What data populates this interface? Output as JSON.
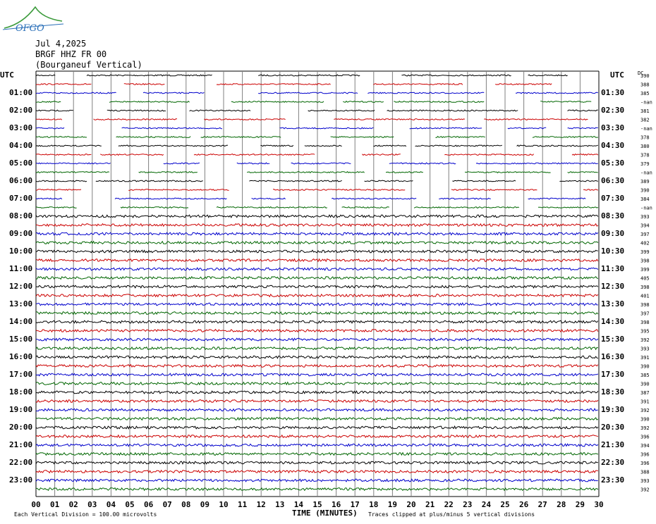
{
  "logo": {
    "text": "OFGO"
  },
  "header": {
    "date": "Jul 4,2025",
    "station": "BRGF HHZ FR 00",
    "location": "(Bourganeuf Vertical)"
  },
  "axis": {
    "left_label": "UTC",
    "right_label": "UTC",
    "dc_label": "DC",
    "xlabel": "TIME (MINUTES)",
    "left_ticks": [
      "01:00",
      "02:00",
      "03:00",
      "04:00",
      "05:00",
      "06:00",
      "07:00",
      "08:00",
      "09:00",
      "10:00",
      "11:00",
      "12:00",
      "13:00",
      "14:00",
      "15:00",
      "16:00",
      "17:00",
      "18:00",
      "19:00",
      "20:00",
      "21:00",
      "22:00",
      "23:00"
    ],
    "right_ticks": [
      "01:30",
      "02:30",
      "03:30",
      "04:30",
      "05:30",
      "06:30",
      "07:30",
      "08:30",
      "09:30",
      "10:30",
      "11:30",
      "12:30",
      "13:30",
      "14:30",
      "15:30",
      "16:30",
      "17:30",
      "18:30",
      "19:30",
      "20:30",
      "21:30",
      "22:30",
      "23:30"
    ],
    "x_ticks": [
      "00",
      "01",
      "02",
      "03",
      "04",
      "05",
      "06",
      "07",
      "08",
      "09",
      "10",
      "11",
      "12",
      "13",
      "14",
      "15",
      "16",
      "17",
      "18",
      "19",
      "20",
      "21",
      "22",
      "23",
      "24",
      "25",
      "26",
      "27",
      "28",
      "29",
      "30"
    ]
  },
  "footer": {
    "scale": "Each Vertical Division =  100.00 microvolts",
    "clip": "Traces clipped at plus/minus 5 vertical divisions"
  },
  "colors": {
    "black": "#000000",
    "red": "#cc0000",
    "blue": "#0000cc",
    "green": "#006600",
    "grid": "#808080"
  },
  "chart_data": {
    "type": "line",
    "title": "BRGF HHZ FR 00 (Bourganeuf Vertical)",
    "xlabel": "TIME (MINUTES)",
    "xlim": [
      0,
      30
    ],
    "row_interval_minutes": 30,
    "trace_colors_cycle": [
      "black",
      "red",
      "blue",
      "green"
    ],
    "dc_offsets": [
      "390",
      "388",
      "385",
      "-nan",
      "381",
      "382",
      "-nan",
      "378",
      "380",
      "378",
      "379",
      "-nan",
      "389",
      "390",
      "384",
      "-nan",
      "393",
      "394",
      "397",
      "402",
      "399",
      "398",
      "399",
      "405",
      "398",
      "401",
      "398",
      "397",
      "398",
      "395",
      "392",
      "393",
      "391",
      "390",
      "385",
      "390",
      "387",
      "391",
      "392",
      "390",
      "392",
      "396",
      "394",
      "396",
      "396",
      "388",
      "393",
      "392"
    ],
    "gaps_in_data_until": "08:00"
  }
}
